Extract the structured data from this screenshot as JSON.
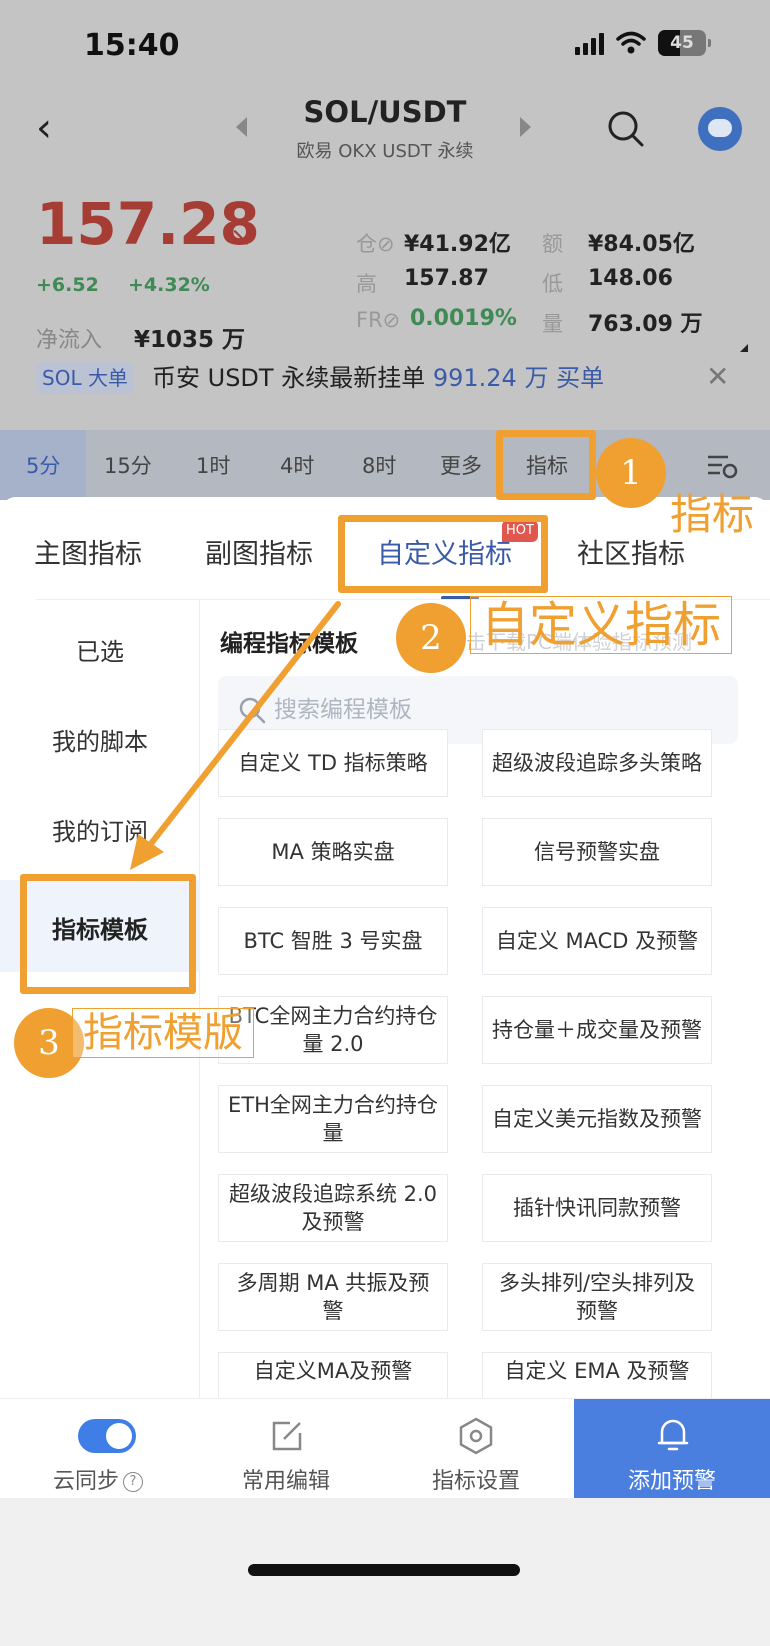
{
  "status": {
    "time": "15:40",
    "battery": "45"
  },
  "nav": {
    "pair": "SOL/USDT",
    "exchange": "欧易 OKX USDT 永续"
  },
  "ticker": {
    "price": "157.28",
    "arrow": "↘",
    "change_abs": "+6.52",
    "change_pct": "+4.32%",
    "inflow_label": "净流入",
    "inflow_value": "¥1035 万",
    "stats": [
      {
        "label": "仓⊘",
        "value": "¥41.92亿"
      },
      {
        "label": "额",
        "value": "¥84.05亿"
      },
      {
        "label": "高",
        "value": "157.87"
      },
      {
        "label": "低",
        "value": "148.06"
      },
      {
        "label": "FR⊘",
        "value": "0.0019%"
      },
      {
        "label": "量",
        "value": "763.09 万"
      }
    ]
  },
  "announcement": {
    "tag": "SOL 大单",
    "text": "币安 USDT 永续最新挂单",
    "amount": "991.24 万",
    "action": "买单"
  },
  "timeframes": [
    "5分",
    "15分",
    "1时",
    "4时",
    "8时",
    "更多",
    "指标"
  ],
  "sheet": {
    "tabs": [
      "主图指标",
      "副图指标",
      "自定义指标",
      "社区指标"
    ],
    "hot_badge": "HOT",
    "left_nav": [
      "已选",
      "我的脚本",
      "我的订阅",
      "指标模板"
    ],
    "content_title": "编程指标模板",
    "content_hint": "击下载PC端体验指标预测",
    "search_placeholder": "搜索编程模板",
    "templates": [
      "自定义 TD 指标策略",
      "超级波段追踪多头策略",
      "MA 策略实盘",
      "信号预警实盘",
      "BTC 智胜 3 号实盘",
      "自定义 MACD 及预警",
      "BTC全网主力合约持仓量 2.0",
      "持仓量＋成交量及预警",
      "ETH全网主力合约持仓量",
      "自定义美元指数及预警",
      "超级波段追踪系统 2.0 及预警",
      "插针快讯同款预警",
      "多周期 MA 共振及预警",
      "多头排列/空头排列及预警",
      "自定义MA及预警",
      "自定义 EMA 及预警"
    ]
  },
  "actions": {
    "sync": "云同步",
    "edit": "常用编辑",
    "settings": "指标设置",
    "alert": "添加预警"
  },
  "annotations": {
    "step1_num": "1",
    "step1_label": "指标",
    "step2_num": "2",
    "step2_label": "自定义指标",
    "step3_num": "3",
    "step3_label": "指标模版"
  },
  "colors": {
    "accent": "#3a5ba8",
    "annotation": "#f0a030",
    "price_red": "#a63d35",
    "gain_green": "#3f8a55",
    "primary_button": "#4a7fe0"
  }
}
